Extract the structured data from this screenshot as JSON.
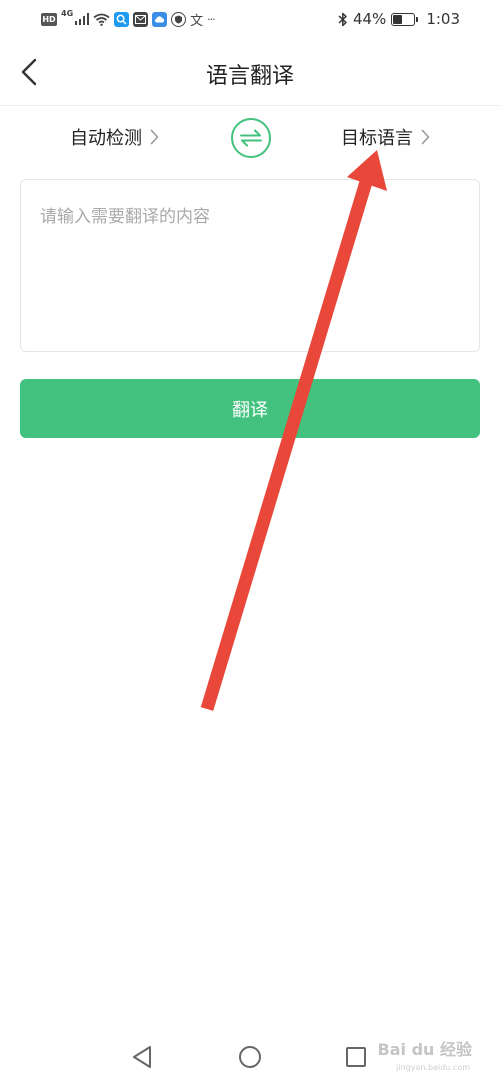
{
  "status_bar": {
    "network_label": "4G",
    "battery_percent_label": "44%",
    "battery_level": 0.44,
    "time": "1:03",
    "extra_text_icon": "文",
    "more_indicator": "···",
    "icons": [
      "hd-icon",
      "signal-icon",
      "wifi-icon",
      "search-app-icon",
      "mail-app-icon",
      "cloud-app-icon",
      "shield-app-icon",
      "bluetooth-icon",
      "battery-icon"
    ]
  },
  "header": {
    "title": "语言翻译",
    "back_icon": "chevron-left-icon"
  },
  "language_bar": {
    "source_label": "自动检测",
    "target_label": "目标语言",
    "swap_icon": "swap-icon",
    "chevron_icon": "chevron-right-icon"
  },
  "input": {
    "placeholder": "请输入需要翻译的内容",
    "value": ""
  },
  "translate_button": {
    "label": "翻译"
  },
  "colors": {
    "accent": "#43c17e",
    "annotation_arrow": "#e8473a"
  },
  "nav_bar": {
    "icons": [
      "back-triangle-icon",
      "home-circle-icon",
      "recents-square-icon"
    ]
  },
  "watermark": {
    "text": "Bai du 经验",
    "sub": "jingyan.baidu.com"
  }
}
